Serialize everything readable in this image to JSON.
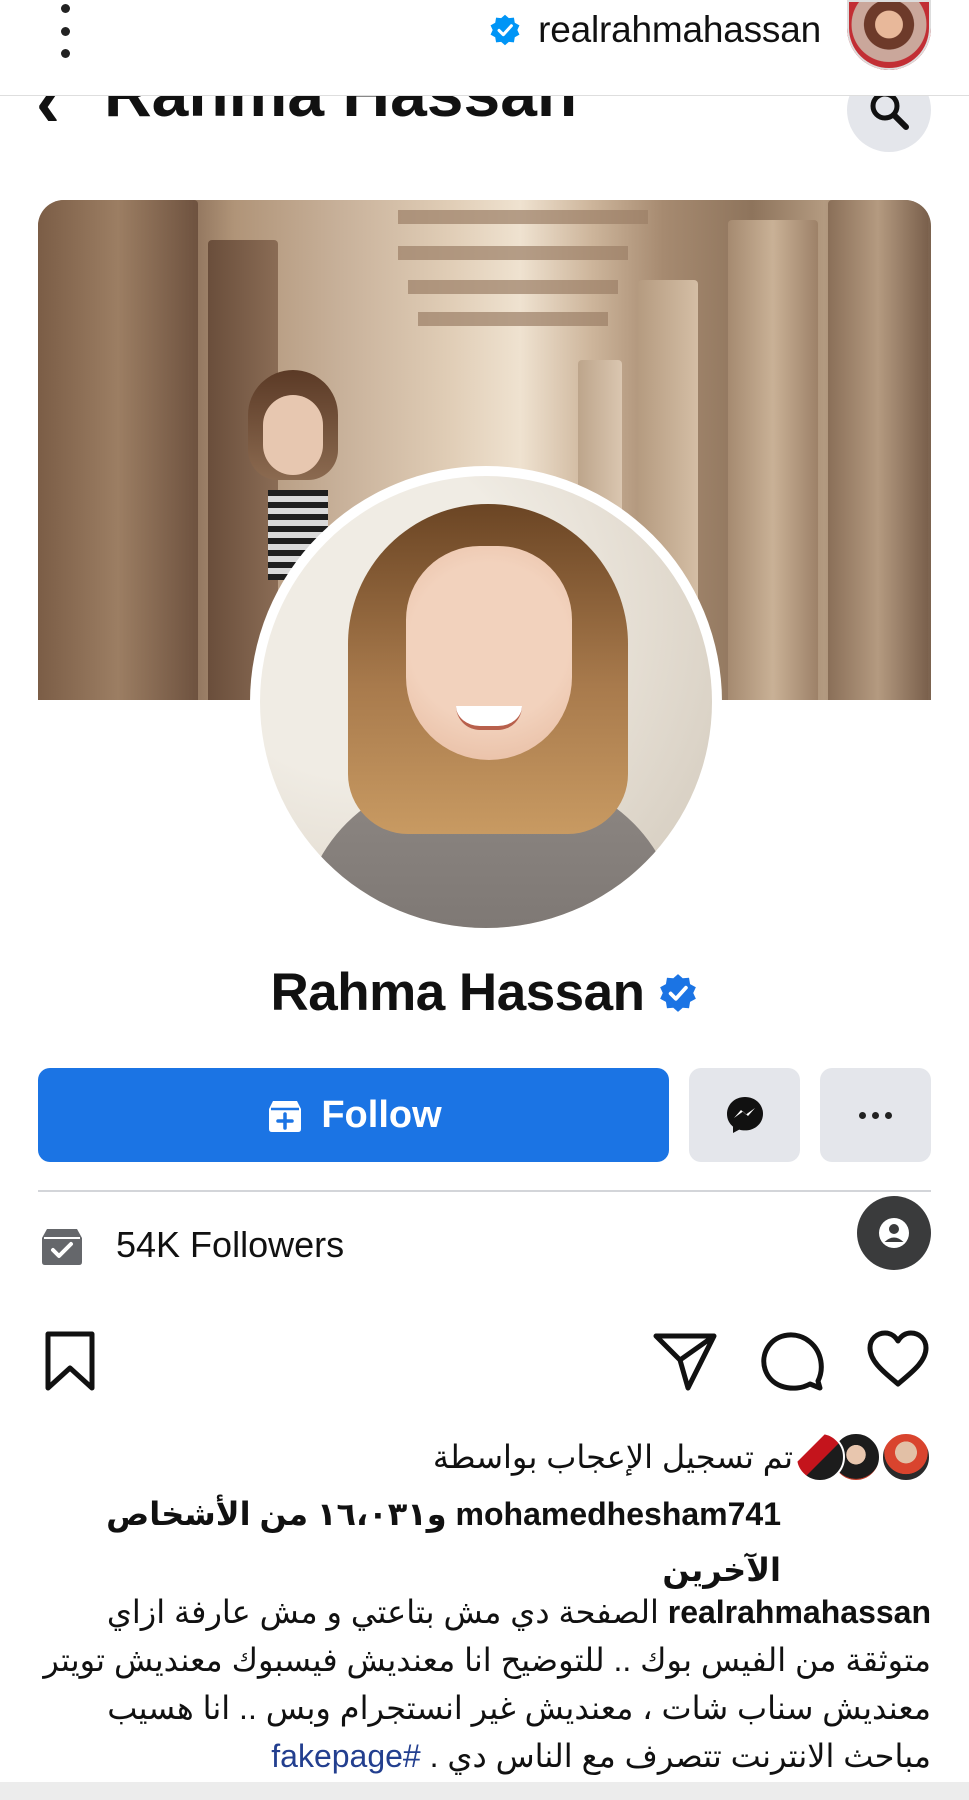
{
  "ig_header": {
    "username": "realrahmahassan",
    "menu_icon": "kebab-vertical-icon",
    "verified_icon": "verified-badge-icon"
  },
  "fb_header": {
    "title": "Rahma Hassan",
    "back_icon": "chevron-left-icon",
    "search_icon": "search-icon"
  },
  "profile": {
    "name": "Rahma Hassan",
    "verified": true
  },
  "actions": {
    "follow_label": "Follow",
    "follow_icon": "follow-plus-icon",
    "messenger_icon": "messenger-icon",
    "more_icon": "more-dots-icon"
  },
  "followers": {
    "text": "54K Followers",
    "icon": "followers-check-icon",
    "user_icon": "user-circle-icon"
  },
  "ig_actions": {
    "save_icon": "bookmark-icon",
    "share_icon": "send-icon",
    "comment_icon": "comment-icon",
    "like_icon": "heart-icon"
  },
  "likes": {
    "label": "تم تسجيل الإعجاب بواسطة",
    "liker": "mohamedhesham741",
    "others": "و١٦،٠٣١ من الأشخاص الآخرين"
  },
  "caption": {
    "user": "realrahmahassan",
    "text": "الصفحة دي مش بتاعتي و مش عارفة ازاي متوثقة من الفيس بوك .. للتوضيح انا معنديش فيسبوك معنديش تويتر معنديش سناب شات ، معنديش غير انستجرام وبس .. انا هسيب مباحث الانترنت تتصرف مع الناس دي .",
    "hashtag": "#fakepage"
  },
  "colors": {
    "fb_blue": "#1b74e4",
    "ig_verified": "#0095f6",
    "button_gray": "#e4e6eb",
    "hashtag": "#233f8f"
  }
}
